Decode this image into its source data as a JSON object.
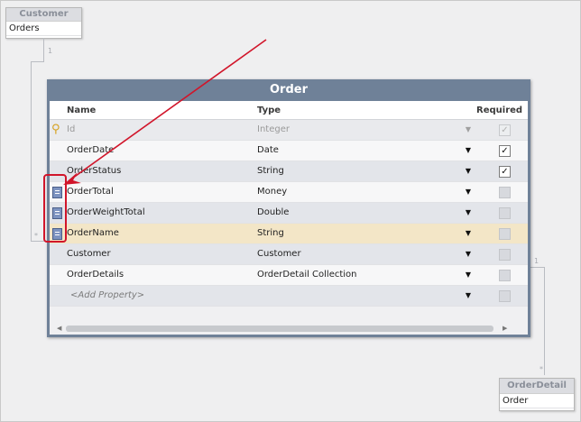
{
  "customer_entity": {
    "title": "Customer",
    "property": "Orders"
  },
  "order_detail_entity": {
    "title": "OrderDetail",
    "property": "Order"
  },
  "multiplicities": {
    "customer_one": "1",
    "customer_many": "*",
    "detail_one": "1",
    "detail_many": "*"
  },
  "order_entity": {
    "title": "Order",
    "columns": {
      "name": "Name",
      "type": "Type",
      "required": "Required"
    },
    "rows": [
      {
        "name": "Id",
        "type": "Integer",
        "required": true,
        "key": true
      },
      {
        "name": "OrderDate",
        "type": "Date",
        "required": true
      },
      {
        "name": "OrderStatus",
        "type": "String",
        "required": true
      },
      {
        "name": "OrderTotal",
        "type": "Money",
        "required": false
      },
      {
        "name": "OrderWeightTotal",
        "type": "Double",
        "required": false
      },
      {
        "name": "OrderName",
        "type": "String",
        "required": false,
        "selected": true
      },
      {
        "name": "Customer",
        "type": "Customer",
        "required": false
      },
      {
        "name": "OrderDetails",
        "type": "OrderDetail Collection",
        "required": false
      },
      {
        "name": "<Add Property>",
        "type": "",
        "required": false
      }
    ]
  },
  "icons": {
    "key": "key-icon",
    "property": "property-icon",
    "dropdown": "chevron-down-icon",
    "checked": "check-icon"
  },
  "annotation_color": "#d1152a",
  "header_color": "#6f8198",
  "selected_row_color": "#f3e6c7"
}
